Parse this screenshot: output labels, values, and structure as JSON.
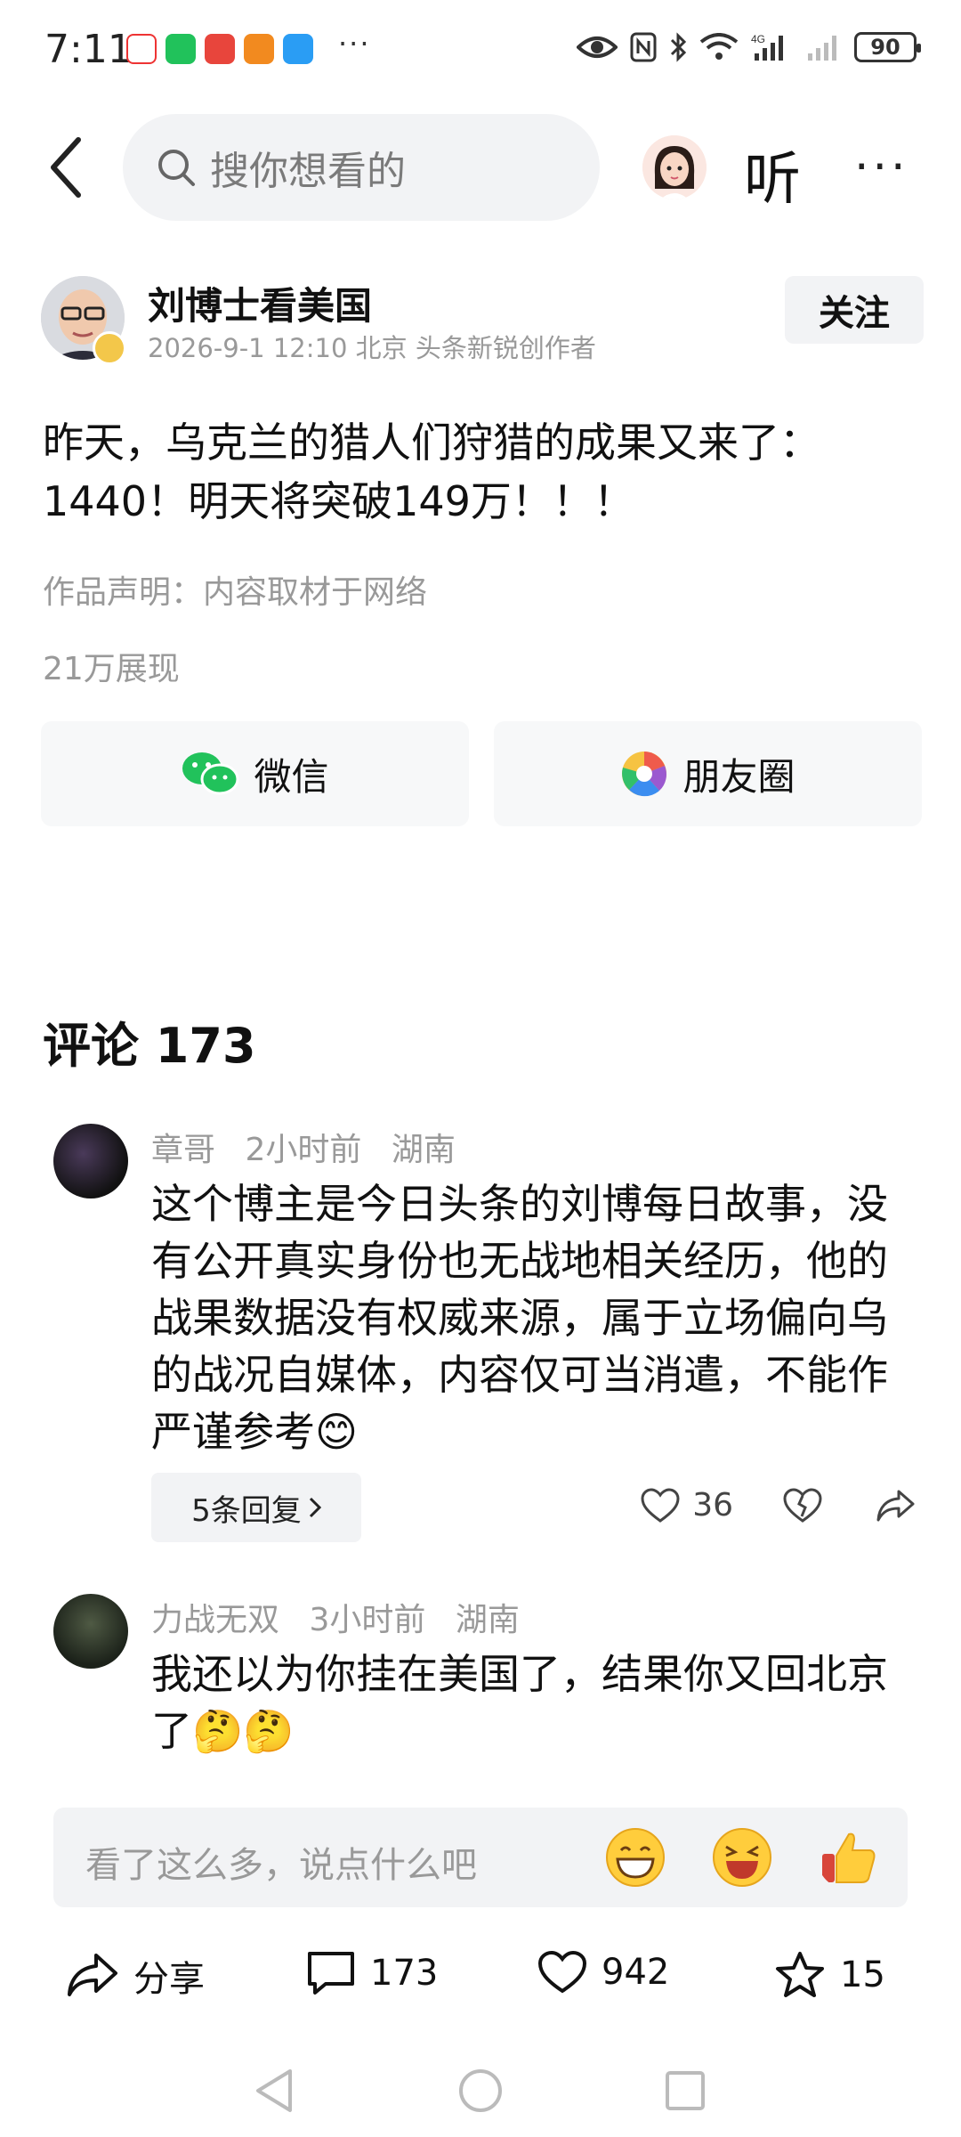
{
  "status_bar": {
    "time": "7:11",
    "dots": "···",
    "battery": "90"
  },
  "nav": {
    "search_placeholder": "搜你想看的",
    "listen_label": "听",
    "more_label": "···"
  },
  "author": {
    "name": "刘博士看美国",
    "meta": "2026-9-1 12:10 北京 头条新锐创作者",
    "follow_label": "关注"
  },
  "post": {
    "text": "昨天，乌克兰的猎人们狩猎的成果又来了：1440！明天将突破149万！！！",
    "statement": "作品声明：内容取材于网络",
    "views": "21万展现"
  },
  "share": {
    "wechat_label": "微信",
    "moments_label": "朋友圈"
  },
  "comments": {
    "title": "评论 173",
    "items": [
      {
        "user": "章哥",
        "time": "2小时前",
        "location": "湖南",
        "text": "这个博主是今日头条的刘博每日故事，没有公开真实身份也无战地相关经历，他的战果数据没有权威来源，属于立场偏向乌的战况自媒体，内容仅可当消遣，不能作严谨参考😊",
        "replies_label": "5条回复",
        "likes": "36"
      },
      {
        "user": "力战无双",
        "time": "3小时前",
        "location": "湖南",
        "text": "我还以为你挂在美国了，结果你又回北京了🤔🤔"
      }
    ]
  },
  "comment_input": {
    "placeholder": "看了这么多，说点什么吧"
  },
  "bottom_bar": {
    "share_label": "分享",
    "comments_count": "173",
    "likes_count": "942",
    "favorites_count": "15"
  },
  "colors": {
    "accent_wechat": "#21c25b",
    "muted_text": "#999999",
    "pill_bg": "#f2f3f5"
  }
}
